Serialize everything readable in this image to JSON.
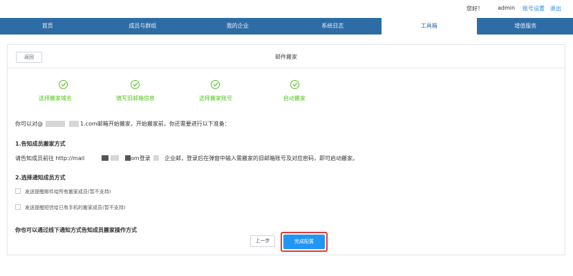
{
  "topbar": {
    "greeting": "您好！",
    "username": "admin",
    "account_settings": "账号设置",
    "logout": "退出"
  },
  "nav": {
    "items": [
      "首页",
      "成员与群组",
      "我的企业",
      "系统日志",
      "工具箱",
      "增值服务"
    ],
    "active": "工具箱"
  },
  "panel": {
    "back_label": "返回",
    "title": "邮件搬家"
  },
  "steps": [
    "选择搬家域名",
    "填写旧邮箱信息",
    "选择搬家账号",
    "启动搬家"
  ],
  "content": {
    "intro_prefix": "你可以对@",
    "intro_suffix": "1.com邮箱开始搬家，开始搬家前，你还需要进行以下准备：",
    "section1_title": "1.告知成员搬家方式",
    "section1_prefix": "请告知成员前往 http://mail",
    "section1_mid": "om登录",
    "section1_suffix": "企业邮，登录后在弹窗中输入需搬家的旧邮箱账号及对应密码，即可启动搬家。",
    "section2_title": "2.选择通知成员方式",
    "option1": "发送提醒邮件给所有搬家成员(暂不支持)",
    "option2": "发送提醒短信给已有手机的搬家成员(暂不支持)",
    "offline_note": "你也可以通过线下通知方式告知成员搬家操作方式"
  },
  "footer": {
    "prev_label": "上一步",
    "done_label": "完成配置"
  },
  "colors": {
    "nav_bg": "#2e6ca6",
    "step_green": "#52c41a",
    "primary_blue": "#2196f3",
    "highlight_red": "#e53935",
    "link_blue": "#2a8ae0"
  }
}
